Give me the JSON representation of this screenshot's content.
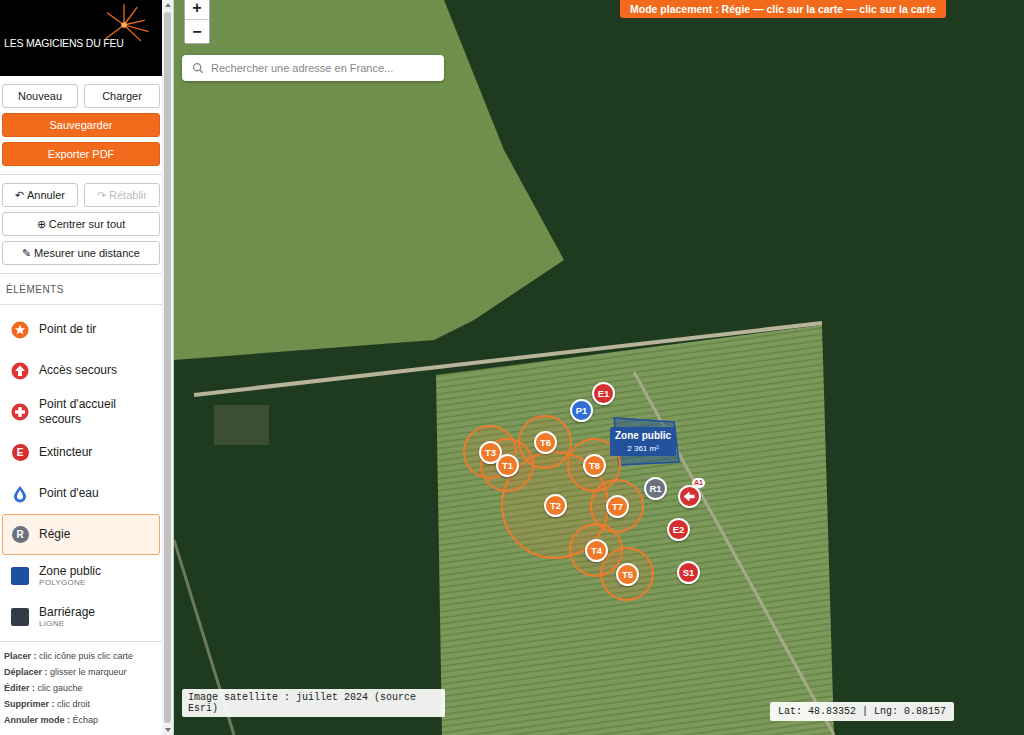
{
  "logo": {
    "text": "LES MAGICIENS DU FEU"
  },
  "file_buttons": [
    {
      "label": "Nouveau"
    },
    {
      "label": "Charger"
    }
  ],
  "main_buttons": [
    {
      "label": "Sauvegarder"
    },
    {
      "label": "Exporter PDF"
    }
  ],
  "history_buttons": [
    {
      "icon": "↶",
      "label": "Annuler",
      "disabled": false
    },
    {
      "icon": "↷",
      "label": "Rétablir",
      "disabled": true
    }
  ],
  "tool_buttons": [
    {
      "icon": "⊕",
      "label": "Centrer sur tout"
    },
    {
      "icon": "✎",
      "label": "Mesurer une distance"
    }
  ],
  "elements": {
    "heading": "ÉLÉMENTS",
    "items": [
      {
        "label": "Point de tir",
        "sub": "",
        "kind": "star",
        "glyph": "",
        "color": "#f26b1d",
        "selected": false
      },
      {
        "label": "Accès secours",
        "sub": "",
        "kind": "arrow",
        "glyph": "",
        "color": "#e03333",
        "selected": false
      },
      {
        "label": "Point d'accueil secours",
        "sub": "",
        "kind": "cross",
        "glyph": "",
        "color": "#e03333",
        "selected": false
      },
      {
        "label": "Extincteur",
        "sub": "",
        "kind": "letter",
        "glyph": "E",
        "color": "#d62f2f",
        "selected": false
      },
      {
        "label": "Point d'eau",
        "sub": "",
        "kind": "drop",
        "glyph": "",
        "color": "#2f6fd6",
        "selected": false
      },
      {
        "label": "Régie",
        "sub": "",
        "kind": "letter",
        "glyph": "R",
        "color": "#6b7280",
        "selected": true
      },
      {
        "label": "Zone public",
        "sub": "POLYGONE",
        "kind": "square",
        "glyph": "",
        "color": "#1f4fa0",
        "selected": false
      },
      {
        "label": "Barriérage",
        "sub": "LIGNE",
        "kind": "square",
        "glyph": "",
        "color": "#333a48",
        "selected": false
      }
    ]
  },
  "help": [
    {
      "key": "Placer :",
      "text": "clic icône puis clic carte"
    },
    {
      "key": "Déplacer :",
      "text": "glisser le marqueur"
    },
    {
      "key": "Éditer :",
      "text": "clic gauche"
    },
    {
      "key": "Supprimer :",
      "text": "clic droit"
    },
    {
      "key": "Annuler mode :",
      "text": "Échap"
    }
  ],
  "map": {
    "zoom": [
      "+",
      "−"
    ],
    "search": {
      "placeholder": "Rechercher une adresse en France..."
    },
    "mode_banner": "Mode placement : Régie — clic sur la carte — clic sur la carte",
    "zone": {
      "label": "Zone public",
      "area": "2 361 m²"
    },
    "markers": [
      {
        "label": "T3",
        "kind": "tir",
        "color": "#f07a2a"
      },
      {
        "label": "T1",
        "kind": "tir",
        "color": "#f07a2a"
      },
      {
        "label": "T6",
        "kind": "tir",
        "color": "#f07a2a"
      },
      {
        "label": "T8",
        "kind": "tir",
        "color": "#f07a2a"
      },
      {
        "label": "T2",
        "kind": "tir",
        "color": "#f07a2a"
      },
      {
        "label": "T7",
        "kind": "tir",
        "color": "#f07a2a"
      },
      {
        "label": "T4",
        "kind": "tir",
        "color": "#f07a2a"
      },
      {
        "label": "T5",
        "kind": "tir",
        "color": "#f07a2a"
      },
      {
        "label": "E1",
        "kind": "round",
        "color": "#d62f2f"
      },
      {
        "label": "P1",
        "kind": "round",
        "color": "#2f6fd6"
      },
      {
        "label": "R1",
        "kind": "round",
        "color": "#6b7280"
      },
      {
        "label": "A1",
        "kind": "arrow",
        "color": "#d62f2f"
      },
      {
        "label": "E2",
        "kind": "round",
        "color": "#d62f2f"
      },
      {
        "label": "S1",
        "kind": "round",
        "color": "#d62f2f"
      }
    ],
    "attribution": "Image satellite : juillet 2024 (source Esri)",
    "coordinates": "Lat: 48.83352 | Lng: 0.88157"
  }
}
